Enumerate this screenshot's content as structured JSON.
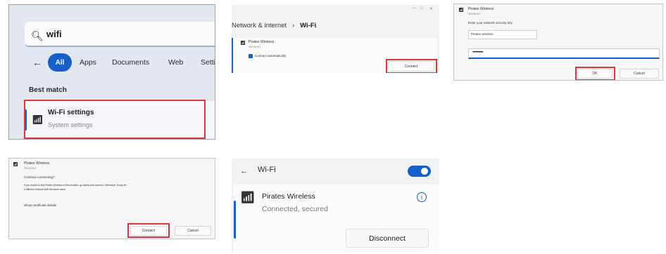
{
  "search_panel": {
    "query": "wifi",
    "filters": [
      "All",
      "Apps",
      "Documents",
      "Web",
      "Setti"
    ],
    "section_heading": "Best match",
    "result_title": "Wi-Fi settings",
    "result_subtitle": "System settings"
  },
  "network_panel": {
    "breadcrumb_parent": "Network & internet",
    "breadcrumb_current": "Wi-Fi",
    "network_name": "Pirates Wireless",
    "network_status": "Secured",
    "auto_connect_label": "Connect automatically",
    "connect_label": "Connect"
  },
  "password_panel": {
    "network_name": "Pirates Wireless",
    "network_status": "Secured",
    "prompt": "Enter your network security key",
    "field_text": "Pirates wireless",
    "password_mask": "•••••••••••••",
    "ok_label": "OK",
    "cancel_label": "Cancel"
  },
  "confirm_panel": {
    "network_name": "Pirates Wireless",
    "network_status": "Secured",
    "question": "Continue connecting?",
    "message_line1": "If you expect to find Pirates Wireless in this location, go ahead and connect. Otherwise, it may be",
    "message_line2": "a different network with the same name.",
    "details_link": "Show certificate details",
    "connect_label": "Connect",
    "cancel_label": "Cancel"
  },
  "connected_panel": {
    "title": "Wi-Fi",
    "network_name": "Pirates Wireless",
    "status": "Connected, secured",
    "disconnect_label": "Disconnect",
    "wifi_enabled": true
  },
  "colors": {
    "accent": "#1860c9",
    "highlight_box": "#d9363e"
  }
}
